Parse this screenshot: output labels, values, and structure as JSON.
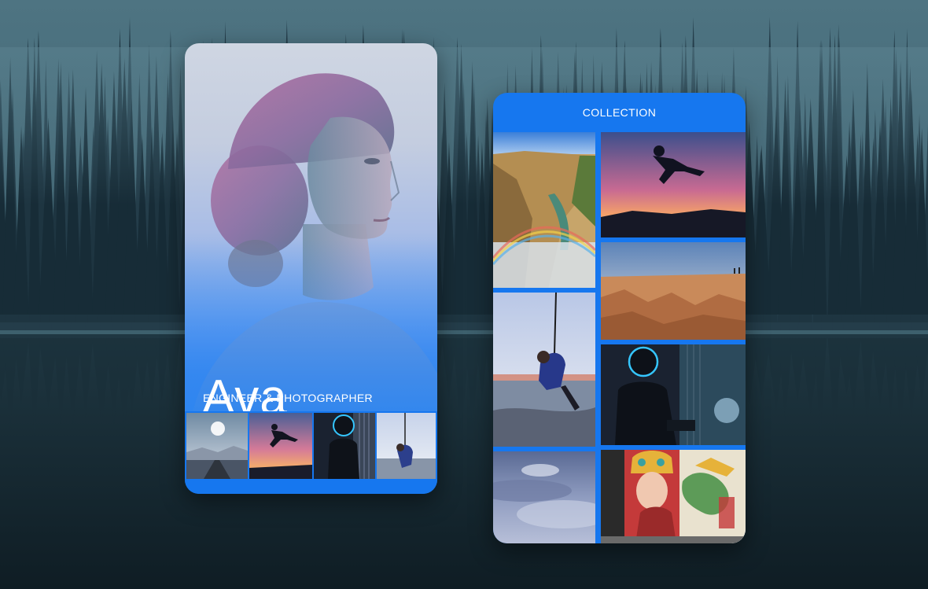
{
  "profile": {
    "name": "Ava",
    "role": "ENGINEER & PHOTOGRAPHER",
    "thumbnails": [
      {
        "icon": "road-landscape-photo"
      },
      {
        "icon": "jumping-silhouette-photo"
      },
      {
        "icon": "helmet-rider-photo"
      },
      {
        "icon": "rope-swing-photo"
      }
    ]
  },
  "collection": {
    "title": "COLLECTION",
    "photos": [
      {
        "icon": "canyon-waterfall-photo"
      },
      {
        "icon": "jumping-silhouette-photo"
      },
      {
        "icon": "desert-canyon-photo"
      },
      {
        "icon": "rope-swing-photo"
      },
      {
        "icon": "helmet-rider-photo"
      },
      {
        "icon": "cloudy-sky-photo"
      },
      {
        "icon": "street-mural-photo"
      }
    ]
  },
  "colors": {
    "accent": "#1677ef",
    "background": "#1a2c35",
    "text": "#ffffff"
  }
}
